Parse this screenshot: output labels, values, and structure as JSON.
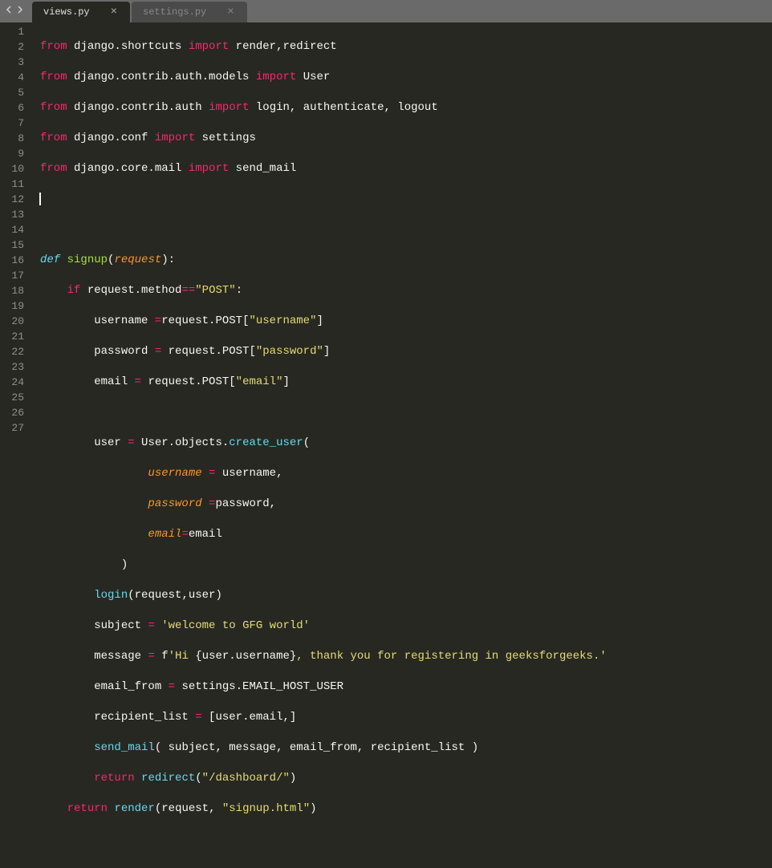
{
  "tabs": [
    {
      "label": "views.py",
      "active": true
    },
    {
      "label": "settings.py",
      "active": false
    }
  ],
  "lines": {
    "count": 27
  },
  "code": {
    "l1": {
      "from": "from",
      "mod": "django.shortcuts",
      "import": "import",
      "items": "render,redirect"
    },
    "l2": {
      "from": "from",
      "mod": "django.contrib.auth.models",
      "import": "import",
      "items": "User"
    },
    "l3": {
      "from": "from",
      "mod": "django.contrib.auth",
      "import": "import",
      "items": "login, authenticate, logout"
    },
    "l4": {
      "from": "from",
      "mod": "django.conf",
      "import": "import",
      "items": "settings"
    },
    "l5": {
      "from": "from",
      "mod": "django.core.mail",
      "import": "import",
      "items": "send_mail"
    },
    "l8": {
      "def": "def",
      "name": "signup",
      "lp": "(",
      "param": "request",
      "rp": "):"
    },
    "l9": {
      "if": "if",
      "subj": "request.method",
      "op": "==",
      "str": "\"POST\"",
      "colon": ":"
    },
    "l10": {
      "lhs": "username ",
      "op": "=",
      "rhs": "request.POST[",
      "str": "\"username\"",
      "close": "]"
    },
    "l11": {
      "lhs": "password ",
      "op": "=",
      "rhs": " request.POST[",
      "str": "\"password\"",
      "close": "]"
    },
    "l12": {
      "lhs": "email ",
      "op": "=",
      "rhs": " request.POST[",
      "str": "\"email\"",
      "close": "]"
    },
    "l14": {
      "lhs": "user ",
      "op": "=",
      "obj": " User.objects.",
      "fn": "create_user",
      "lp": "("
    },
    "l15": {
      "arg": "username",
      "eq": " = ",
      "val": "username,"
    },
    "l16": {
      "arg": "password",
      "eq": " =",
      "val": "password,"
    },
    "l17": {
      "arg": "email",
      "eq": "=",
      "val": "email"
    },
    "l18": {
      "rp": ")"
    },
    "l19": {
      "fn": "login",
      "args": "(request,user)"
    },
    "l20": {
      "lhs": "subject ",
      "op": "=",
      "sp": " ",
      "str": "'welcome to GFG world'"
    },
    "l21": {
      "lhs": "message ",
      "op": "=",
      "sp": " f",
      "str1": "'Hi ",
      "interp": "{user.username}",
      "str2": ", thank you for registering in geeksforgeeks.'"
    },
    "l22": {
      "lhs": "email_from ",
      "op": "=",
      "rhs": " settings.EMAIL_HOST_USER"
    },
    "l23": {
      "lhs": "recipient_list ",
      "op": "=",
      "rhs": " [user.email,]"
    },
    "l24": {
      "fn": "send_mail",
      "args": "( subject, message, email_from, recipient_list )"
    },
    "l25": {
      "ret": "return",
      "sp": " ",
      "fn": "redirect",
      "lp": "(",
      "str": "\"/dashboard/\"",
      "rp": ")"
    },
    "l26": {
      "ret": "return",
      "sp": " ",
      "fn": "render",
      "lp": "(request, ",
      "str": "\"signup.html\"",
      "rp": ")"
    }
  }
}
